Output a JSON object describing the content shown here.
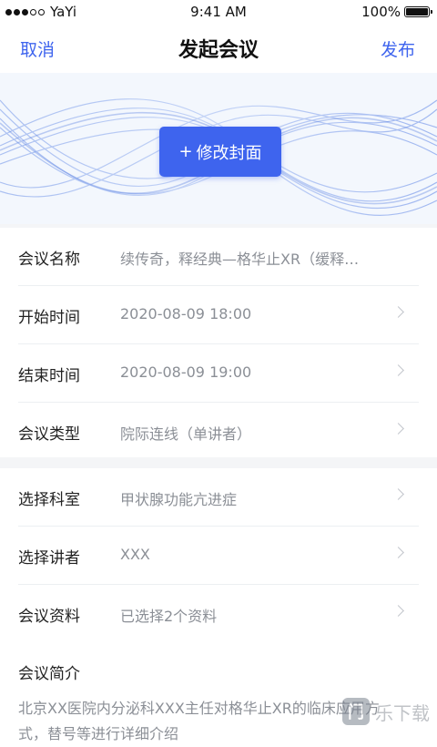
{
  "status_bar": {
    "carrier": "YaYi",
    "time": "9:41 AM",
    "battery": "100%"
  },
  "nav": {
    "cancel": "取消",
    "title": "发起会议",
    "publish": "发布"
  },
  "cover": {
    "button_icon": "+",
    "button_label": "修改封面"
  },
  "section1": [
    {
      "label": "会议名称",
      "value": "续传奇，释经典—格华止XR（缓释…",
      "chevron": false
    },
    {
      "label": "开始时间",
      "value": "2020-08-09 18:00",
      "chevron": true
    },
    {
      "label": "结束时间",
      "value": "2020-08-09 19:00",
      "chevron": true
    },
    {
      "label": "会议类型",
      "value": "院际连线（单讲者）",
      "chevron": true
    }
  ],
  "section2": [
    {
      "label": "选择科室",
      "value": "甲状腺功能亢进症",
      "chevron": true
    },
    {
      "label": "选择讲者",
      "value": "XXX",
      "chevron": true
    },
    {
      "label": "会议资料",
      "value": "已选择2个资料",
      "chevron": true
    }
  ],
  "intro": {
    "label": "会议简介",
    "text": "北京XX医院内分泌科XXX主任对格华止XR的临床应用方式，替号等进行详细介绍"
  },
  "watermark": {
    "logo": "门",
    "text": "乐下载"
  }
}
